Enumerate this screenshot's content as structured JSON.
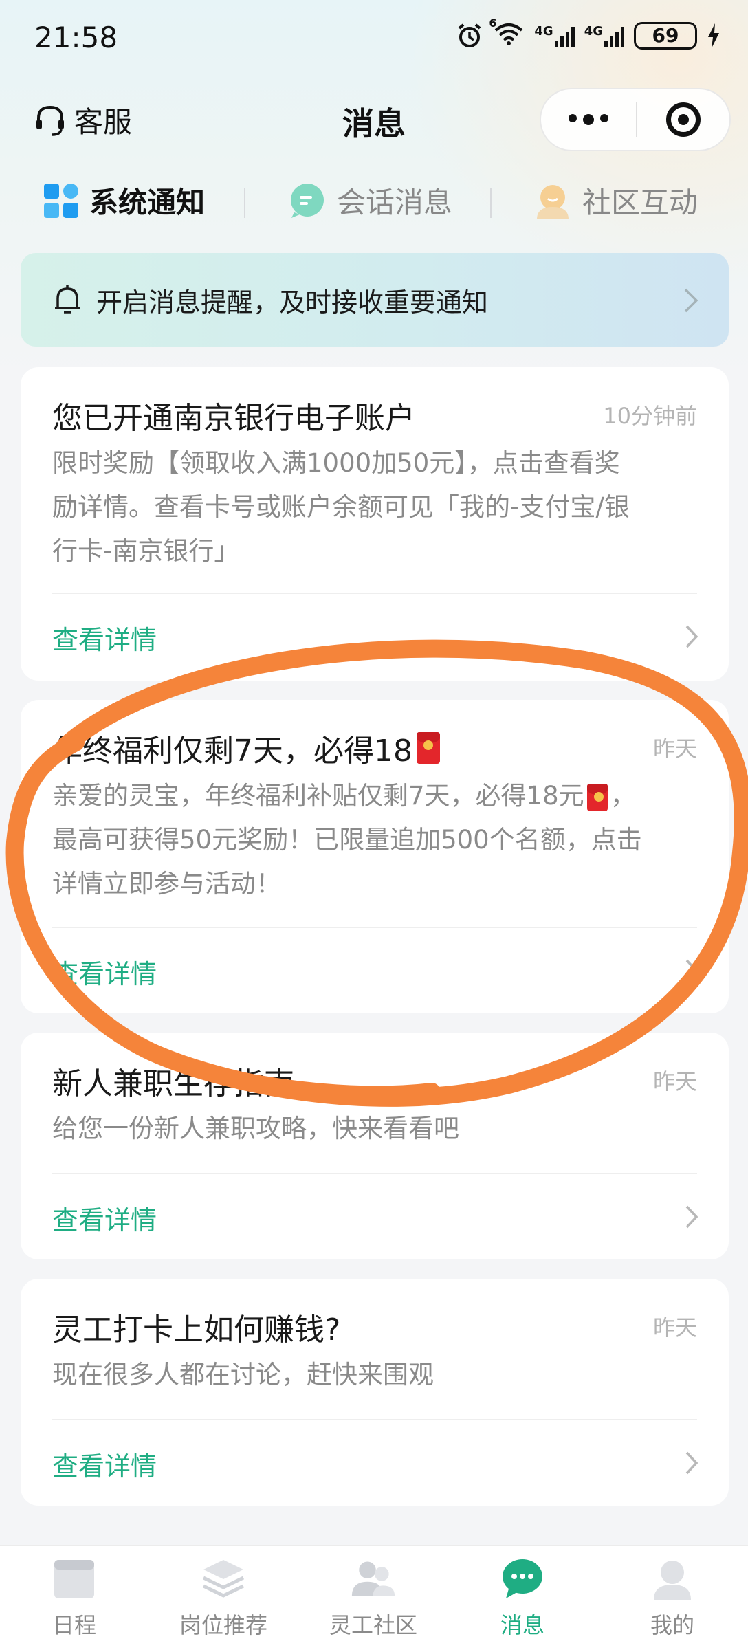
{
  "status": {
    "time": "21:58",
    "battery": "69",
    "net1": "4G",
    "net2": "4G",
    "wifi_sup": "6"
  },
  "header": {
    "service": "客服",
    "title": "消息"
  },
  "tabs": [
    {
      "label": "系统通知",
      "active": true,
      "icon": "grid-icon"
    },
    {
      "label": "会话消息",
      "active": false,
      "icon": "chat-bubble-icon"
    },
    {
      "label": "社区互动",
      "active": false,
      "icon": "avatar-icon"
    }
  ],
  "banner": {
    "text": "开启消息提醒，及时接收重要通知"
  },
  "messages": [
    {
      "title": "您已开通南京银行电子账户",
      "time": "10分钟前",
      "body_lines": [
        "限时奖励【领取收入满1000加50元】，点击查看奖",
        "励详情。查看卡号或账户余额可见「我的-支付宝/银",
        "行卡-南京银行」"
      ],
      "link": "查看详情"
    },
    {
      "title": "年终福利仅剩7天，必得18",
      "time": "昨天",
      "body_lines": [
        "亲爱的灵宝，年终福利补贴仅剩7天，必得18元",
        "最高可获得50元奖励！已限量追加500个名额，点击",
        "详情立即参与活动！"
      ],
      "body_suffix": "，",
      "link": "查看详情"
    },
    {
      "title": "新人兼职生存指南",
      "time": "昨天",
      "body_lines": [
        "给您一份新人兼职攻略，快来看看吧"
      ],
      "link": "查看详情"
    },
    {
      "title": "灵工打卡上如何赚钱?",
      "time": "昨天",
      "body_lines": [
        "现在很多人都在讨论，赶快来围观"
      ],
      "link": "查看详情"
    }
  ],
  "tabbar": [
    {
      "label": "日程",
      "active": false
    },
    {
      "label": "岗位推荐",
      "active": false
    },
    {
      "label": "灵工社区",
      "active": false
    },
    {
      "label": "消息",
      "active": true
    },
    {
      "label": "我的",
      "active": false
    }
  ],
  "colors": {
    "accent": "#1fad83",
    "annotation": "#f5843a",
    "banner_bg": "#d4eeee"
  }
}
